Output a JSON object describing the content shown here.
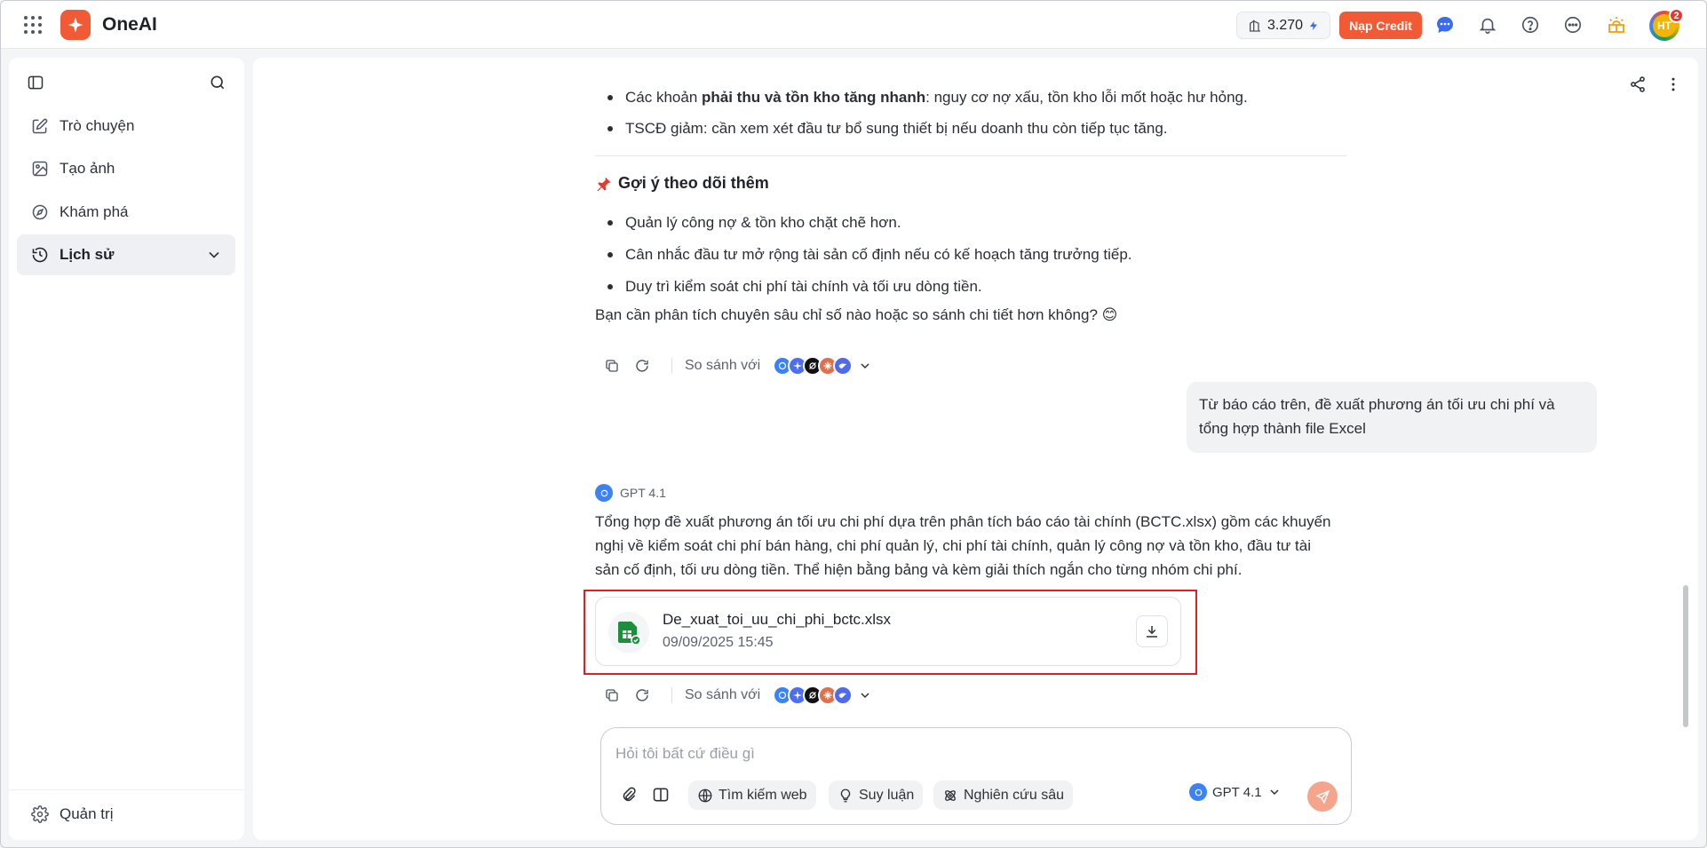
{
  "header": {
    "brand": "OneAI",
    "credit": "3.270",
    "topup_label": "Nạp Credit",
    "avatar_initials": "HT",
    "notification_count": "2",
    "accent_color": "#f15a35"
  },
  "sidebar": {
    "items": [
      {
        "label": "Trò chuyện",
        "icon": "edit-icon"
      },
      {
        "label": "Tạo ảnh",
        "icon": "image-icon"
      },
      {
        "label": "Khám phá",
        "icon": "compass-icon"
      },
      {
        "label": "Lịch sử",
        "icon": "history-icon",
        "active": true
      }
    ],
    "admin_label": "Quản trị"
  },
  "chat": {
    "top_bullets": [
      {
        "pre": "Các khoản ",
        "bold": "phải thu và tồn kho tăng nhanh",
        "post": ": nguy cơ nợ xấu, tồn kho lỗi mốt hoặc hư hỏng."
      },
      {
        "pre": "TSCĐ giảm: cần xem xét đầu tư bổ sung thiết bị nếu doanh thu còn tiếp tục tăng.",
        "bold": "",
        "post": ""
      }
    ],
    "section_heading": "Gợi ý theo dõi thêm",
    "suggestions": [
      "Quản lý công nợ & tồn kho chặt chẽ hơn.",
      "Cân nhắc đầu tư mở rộng tài sản cố định nếu có kế hoạch tăng trưởng tiếp.",
      "Duy trì kiểm soát chi phí tài chính và tối ưu dòng tiền."
    ],
    "closing_question": "Bạn cần phân tích chuyên sâu chỉ số nào hoặc so sánh chi tiết hơn không? 😊",
    "compare_label": "So sánh với",
    "user_message_line1": "Từ báo cáo trên, đề xuất phương án tối ưu chi phí và",
    "user_message_line2": "tổng hợp thành file Excel",
    "model_name": "GPT 4.1",
    "response_line1": "Tổng hợp đề xuất phương án tối ưu chi phí dựa trên phân tích báo cáo tài chính (BCTC.xlsx) gồm các khuyến",
    "response_line2": "nghị về kiểm soát chi phí bán hàng, chi phí quản lý, chi phí tài chính, quản lý công nợ và tồn kho, đầu tư tài",
    "response_line3": "sản cố định, tối ưu dòng tiền. Thể hiện bằng bảng và kèm giải thích ngắn cho từng nhóm chi phí.",
    "file": {
      "name": "De_xuat_toi_uu_chi_phi_bctc.xlsx",
      "date": "09/09/2025 15:45"
    }
  },
  "composer": {
    "placeholder": "Hỏi tôi bất cứ điều gì",
    "web_search": "Tìm kiếm web",
    "reasoning": "Suy luận",
    "deep_research": "Nghiên cứu sâu",
    "model": "GPT 4.1"
  }
}
